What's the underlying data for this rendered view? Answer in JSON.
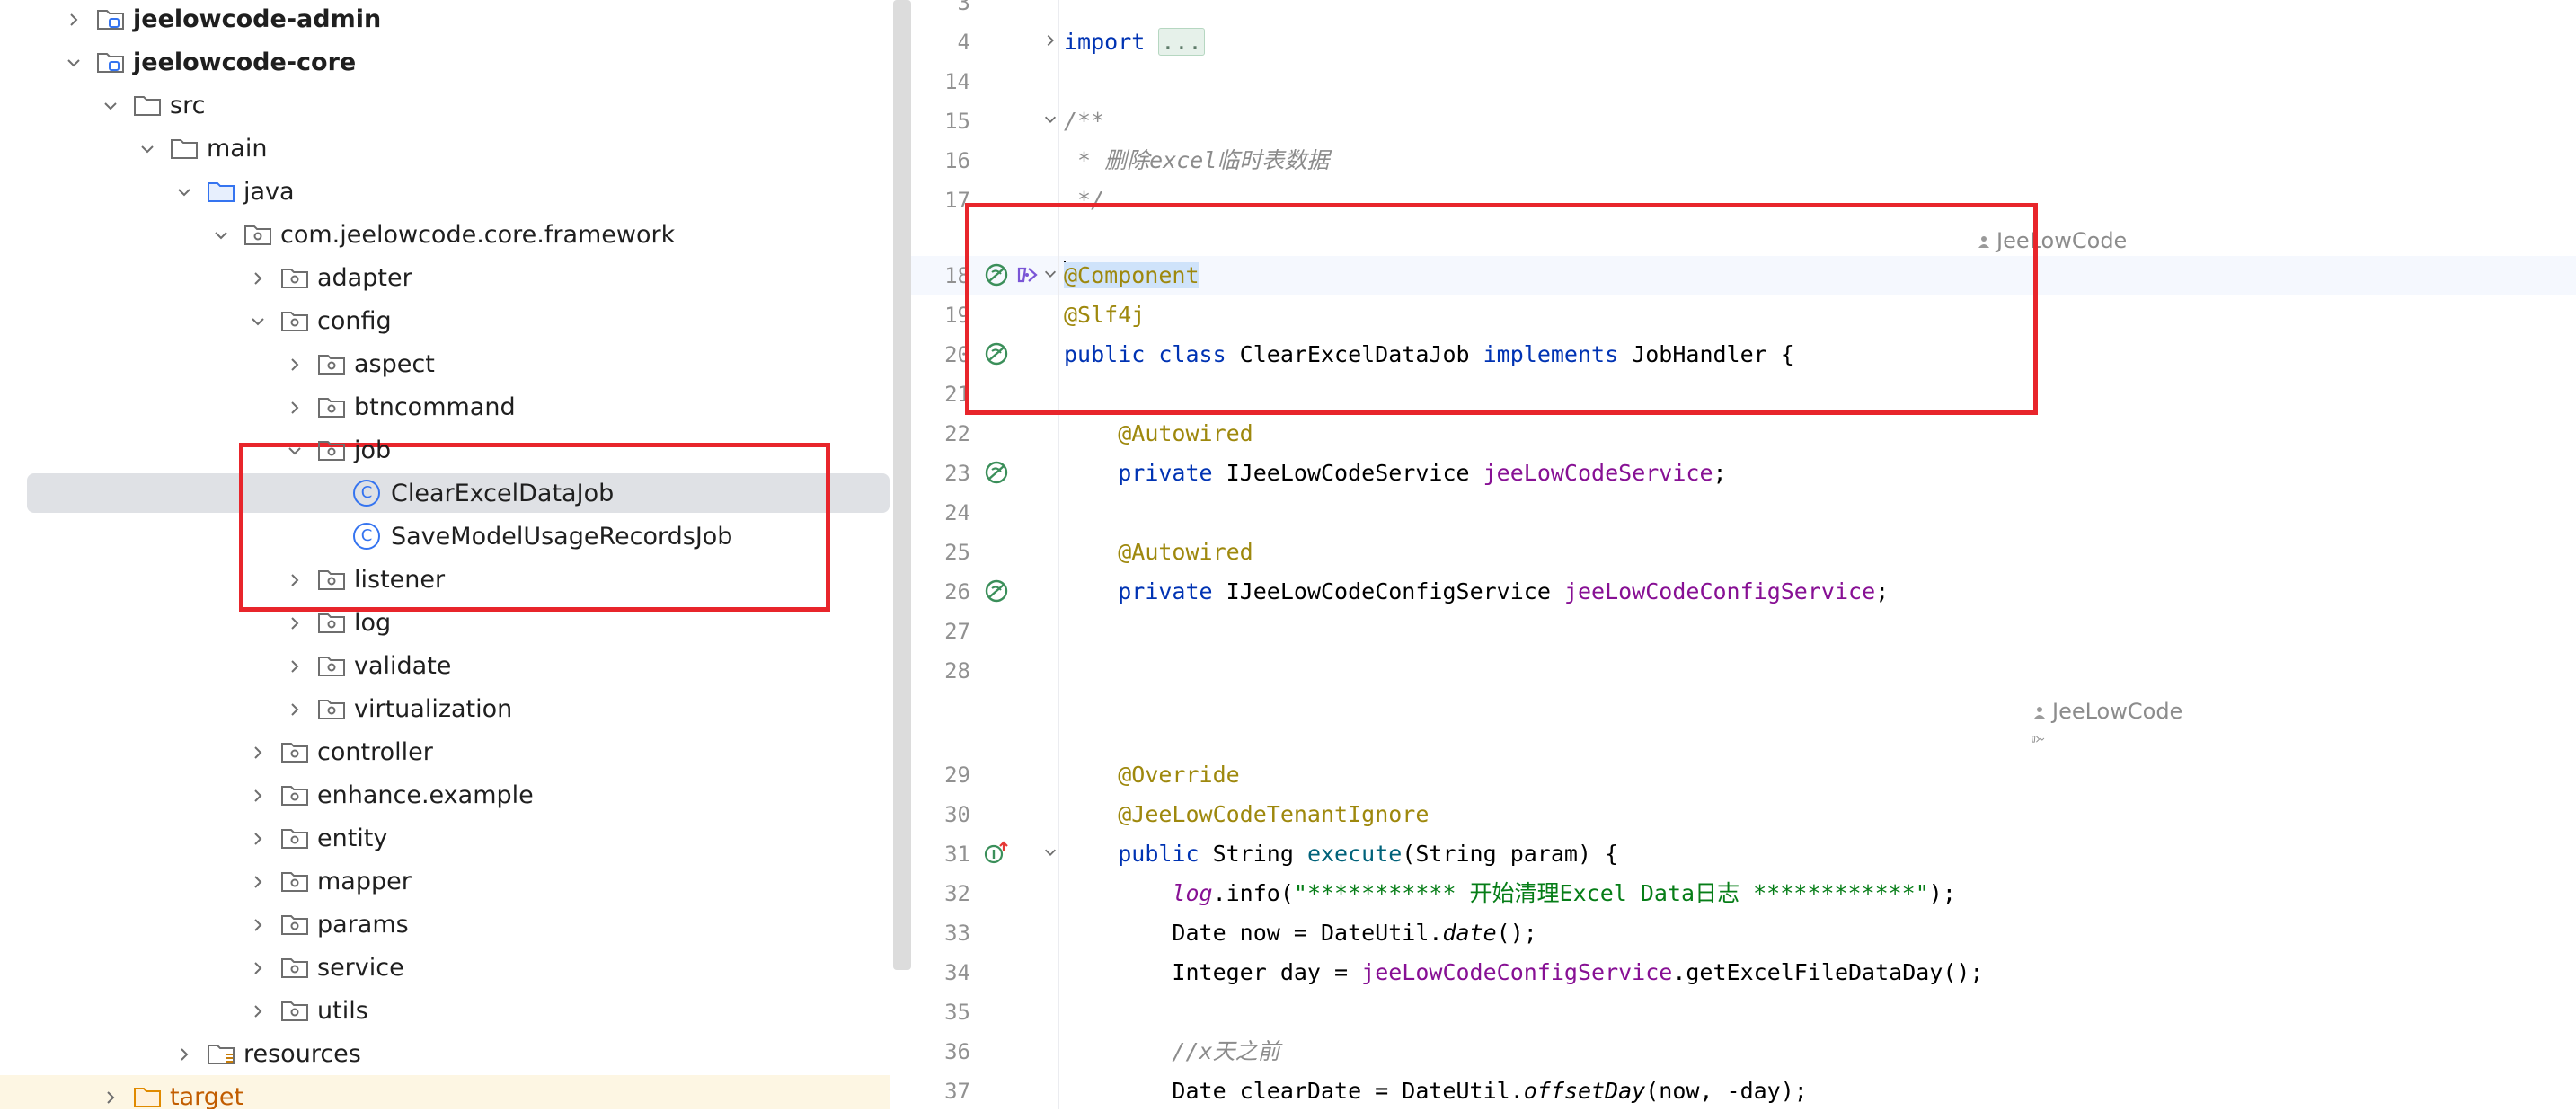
{
  "tree": {
    "items": [
      {
        "label": "jeelowcode-admin",
        "indent": 0,
        "expanded": false,
        "icon": "module-icon",
        "bold": true
      },
      {
        "label": "jeelowcode-core",
        "indent": 0,
        "expanded": true,
        "icon": "module-icon",
        "bold": true
      },
      {
        "label": "src",
        "indent": 1,
        "expanded": true,
        "icon": "folder-icon"
      },
      {
        "label": "main",
        "indent": 2,
        "expanded": true,
        "icon": "folder-icon"
      },
      {
        "label": "java",
        "indent": 3,
        "expanded": true,
        "icon": "source-folder-icon"
      },
      {
        "label": "com.jeelowcode.core.framework",
        "indent": 4,
        "expanded": true,
        "icon": "package-icon"
      },
      {
        "label": "adapter",
        "indent": 5,
        "expanded": false,
        "icon": "package-icon"
      },
      {
        "label": "config",
        "indent": 5,
        "expanded": true,
        "icon": "package-icon"
      },
      {
        "label": "aspect",
        "indent": 6,
        "expanded": false,
        "icon": "package-icon"
      },
      {
        "label": "btncommand",
        "indent": 6,
        "expanded": false,
        "icon": "package-icon"
      },
      {
        "label": "job",
        "indent": 6,
        "expanded": true,
        "icon": "package-icon"
      },
      {
        "label": "ClearExcelDataJob",
        "indent": 7,
        "leaf": true,
        "icon": "class-icon",
        "selected": true
      },
      {
        "label": "SaveModelUsageRecordsJob",
        "indent": 7,
        "leaf": true,
        "icon": "class-icon"
      },
      {
        "label": "listener",
        "indent": 6,
        "expanded": false,
        "icon": "package-icon"
      },
      {
        "label": "log",
        "indent": 6,
        "expanded": false,
        "icon": "package-icon"
      },
      {
        "label": "validate",
        "indent": 6,
        "expanded": false,
        "icon": "package-icon"
      },
      {
        "label": "virtualization",
        "indent": 6,
        "expanded": false,
        "icon": "package-icon"
      },
      {
        "label": "controller",
        "indent": 5,
        "expanded": false,
        "icon": "package-icon"
      },
      {
        "label": "enhance.example",
        "indent": 5,
        "expanded": false,
        "icon": "package-icon"
      },
      {
        "label": "entity",
        "indent": 5,
        "expanded": false,
        "icon": "package-icon"
      },
      {
        "label": "mapper",
        "indent": 5,
        "expanded": false,
        "icon": "package-icon"
      },
      {
        "label": "params",
        "indent": 5,
        "expanded": false,
        "icon": "package-icon"
      },
      {
        "label": "service",
        "indent": 5,
        "expanded": false,
        "icon": "package-icon"
      },
      {
        "label": "utils",
        "indent": 5,
        "expanded": false,
        "icon": "package-icon"
      },
      {
        "label": "resources",
        "indent": 3,
        "expanded": false,
        "icon": "resources-folder-icon"
      },
      {
        "label": "target",
        "indent": 1,
        "expanded": false,
        "icon": "excluded-folder-icon",
        "target": true
      }
    ]
  },
  "editor": {
    "author_hint": "JeeLowCode",
    "lines": [
      {
        "n": "3",
        "tokens": []
      },
      {
        "n": "4",
        "fold": "right",
        "tokens": [
          [
            "kw",
            "import "
          ],
          [
            "foldbox",
            "..."
          ]
        ]
      },
      {
        "n": "14",
        "tokens": []
      },
      {
        "n": "15",
        "fold": "down",
        "tokens": [
          [
            "cmt",
            "/**"
          ]
        ]
      },
      {
        "n": "16",
        "tokens": [
          [
            "cmt",
            " * 删除excel临时表数据"
          ]
        ]
      },
      {
        "n": "17",
        "tokens": [
          [
            "cmt",
            " */"
          ]
        ]
      },
      {
        "hint": true,
        "indent": 0
      },
      {
        "n": "18",
        "current": true,
        "gutter": [
          "bean-icon",
          "spring-component-icon"
        ],
        "fold": "down",
        "tokens": [
          [
            "caret",
            ""
          ],
          [
            "annsel",
            "@Component"
          ]
        ]
      },
      {
        "n": "19",
        "tokens": [
          [
            "ann",
            "@Slf4j"
          ]
        ]
      },
      {
        "n": "20",
        "gutter": [
          "bean-icon"
        ],
        "tokens": [
          [
            "kw",
            "public class "
          ],
          [
            "plain",
            "ClearExcelDataJob "
          ],
          [
            "kw",
            "implements "
          ],
          [
            "plain",
            "JobHandler {"
          ]
        ]
      },
      {
        "n": "21",
        "tokens": []
      },
      {
        "n": "22",
        "tokens": [
          [
            "plain",
            "    "
          ],
          [
            "ann",
            "@Autowired"
          ]
        ]
      },
      {
        "n": "23",
        "gutter": [
          "bean-icon"
        ],
        "tokens": [
          [
            "plain",
            "    "
          ],
          [
            "kw",
            "private "
          ],
          [
            "plain",
            "IJeeLowCodeService "
          ],
          [
            "fld",
            "jeeLowCodeService"
          ],
          [
            "plain",
            ";"
          ]
        ]
      },
      {
        "n": "24",
        "tokens": []
      },
      {
        "n": "25",
        "tokens": [
          [
            "plain",
            "    "
          ],
          [
            "ann",
            "@Autowired"
          ]
        ]
      },
      {
        "n": "26",
        "gutter": [
          "bean-icon"
        ],
        "tokens": [
          [
            "plain",
            "    "
          ],
          [
            "kw",
            "private "
          ],
          [
            "plain",
            "IJeeLowCodeConfigService "
          ],
          [
            "fld",
            "jeeLowCodeConfigService"
          ],
          [
            "plain",
            ";"
          ]
        ]
      },
      {
        "n": "27",
        "tokens": []
      },
      {
        "n": "28",
        "tokens": []
      },
      {
        "hint": true,
        "indent": 1
      },
      {
        "hintIcon": true,
        "indent": 1
      },
      {
        "n": "29",
        "tokens": [
          [
            "plain",
            "    "
          ],
          [
            "ann",
            "@Override"
          ]
        ]
      },
      {
        "n": "30",
        "tokens": [
          [
            "plain",
            "    "
          ],
          [
            "ann",
            "@JeeLowCodeTenantIgnore"
          ]
        ]
      },
      {
        "n": "31",
        "gutter": [
          "implements-icon"
        ],
        "fold": "down",
        "tokens": [
          [
            "plain",
            "    "
          ],
          [
            "kw",
            "public "
          ],
          [
            "plain",
            "String "
          ],
          [
            "fn",
            "execute"
          ],
          [
            "plain",
            "(String param) {"
          ]
        ]
      },
      {
        "n": "32",
        "tokens": [
          [
            "plain",
            "        "
          ],
          [
            "fldi",
            "log"
          ],
          [
            "plain",
            ".info("
          ],
          [
            "str",
            "\"*********** 开始清理Excel Data日志 ************\""
          ],
          [
            "plain",
            ");"
          ]
        ]
      },
      {
        "n": "33",
        "tokens": [
          [
            "plain",
            "        Date now = DateUtil."
          ],
          [
            "ital",
            "date"
          ],
          [
            "plain",
            "();"
          ]
        ]
      },
      {
        "n": "34",
        "tokens": [
          [
            "plain",
            "        Integer day = "
          ],
          [
            "fld",
            "jeeLowCodeConfigService"
          ],
          [
            "plain",
            ".getExcelFileDataDay();"
          ]
        ]
      },
      {
        "n": "35",
        "tokens": []
      },
      {
        "n": "36",
        "tokens": [
          [
            "plain",
            "        "
          ],
          [
            "cmt",
            "//x天之前"
          ]
        ]
      },
      {
        "n": "37",
        "tokens": [
          [
            "plain",
            "        Date clearDate = DateUtil."
          ],
          [
            "ital",
            "offsetDay"
          ],
          [
            "plain",
            "(now, -day);"
          ]
        ]
      }
    ]
  },
  "colors": {
    "keyword": "#0033b3",
    "annotation": "#9e880d",
    "field": "#871094",
    "string": "#067d17",
    "comment": "#8c8c8c",
    "highlight_box": "#e8252b"
  }
}
